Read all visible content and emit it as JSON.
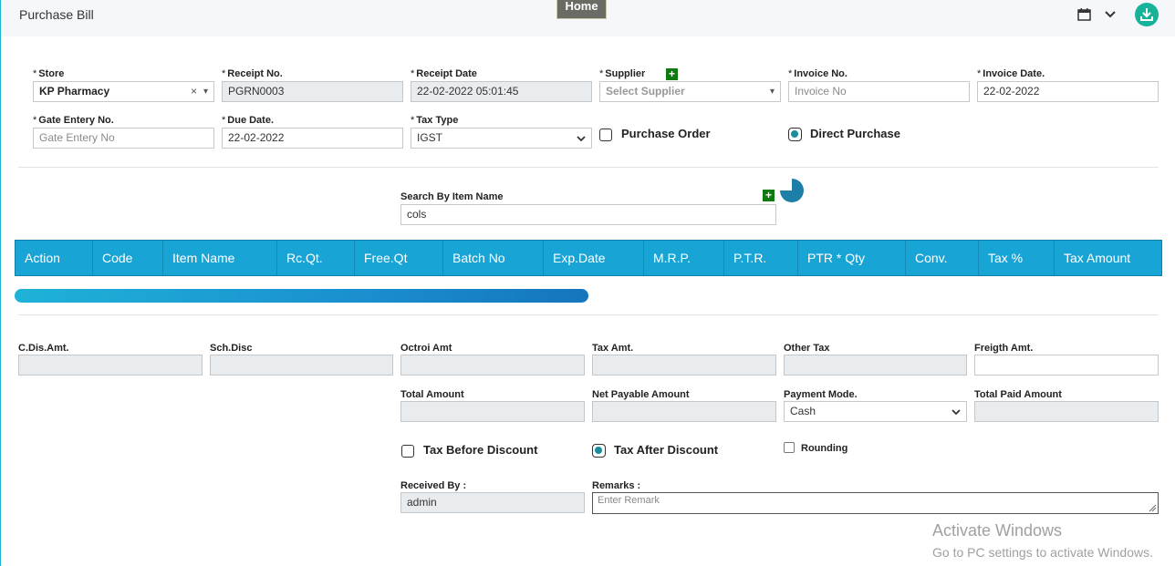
{
  "header": {
    "title": "Purchase Bill",
    "home_tab": "Home",
    "icons": [
      "calendar-icon",
      "chevron-down-icon",
      "download-icon"
    ]
  },
  "form": {
    "store": {
      "label": "Store",
      "value": "KP Pharmacy",
      "clear": "×"
    },
    "receipt_no": {
      "label": "Receipt No.",
      "value": "PGRN0003"
    },
    "receipt_date": {
      "label": "Receipt Date",
      "value": "22-02-2022 05:01:45"
    },
    "supplier": {
      "label": "Supplier",
      "placeholder": "Select Supplier"
    },
    "invoice_no": {
      "label": "Invoice No.",
      "placeholder": "Invoice No"
    },
    "invoice_date": {
      "label": "Invoice Date.",
      "value": "22-02-2022"
    },
    "gate_entry_no": {
      "label": "Gate Entery No.",
      "placeholder": "Gate Entery No"
    },
    "due_date": {
      "label": "Due Date.",
      "value": "22-02-2022"
    },
    "tax_type": {
      "label": "Tax Type",
      "value": "IGST"
    },
    "purchase_order": {
      "label": "Purchase Order",
      "checked": false
    },
    "direct_purchase": {
      "label": "Direct Purchase",
      "checked": true
    },
    "required_mark": "*"
  },
  "search": {
    "label": "Search By Item Name",
    "value": "cols"
  },
  "table": {
    "columns": [
      "Action",
      "Code",
      "Item Name",
      "Rc.Qt.",
      "Free.Qt",
      "Batch No",
      "Exp.Date",
      "M.R.P.",
      "P.T.R.",
      "PTR * Qty",
      "Conv.",
      "Tax %",
      "Tax Amount"
    ]
  },
  "totals": {
    "c_dis_amt": {
      "label": "C.Dis.Amt.",
      "value": ""
    },
    "sch_disc": {
      "label": "Sch.Disc",
      "value": ""
    },
    "octroi_amt": {
      "label": "Octroi Amt",
      "value": ""
    },
    "tax_amt": {
      "label": "Tax Amt.",
      "value": ""
    },
    "other_tax": {
      "label": "Other Tax",
      "value": ""
    },
    "freigth_amt": {
      "label": "Freigth Amt.",
      "value": ""
    },
    "total_amount": {
      "label": "Total Amount",
      "value": ""
    },
    "net_payable_amount": {
      "label": "Net Payable Amount",
      "value": ""
    },
    "payment_mode": {
      "label": "Payment Mode.",
      "value": "Cash"
    },
    "total_paid_amount": {
      "label": "Total Paid Amount",
      "value": ""
    },
    "tax_before_discount": {
      "label": "Tax Before Discount",
      "checked": false
    },
    "tax_after_discount": {
      "label": "Tax After Discount",
      "checked": true
    },
    "rounding": {
      "label": "Rounding",
      "checked": false
    },
    "received_by": {
      "label": "Received By :",
      "value": "admin"
    },
    "remarks": {
      "label": "Remarks :",
      "placeholder": "Enter Remark"
    }
  },
  "watermark": {
    "line1": "Activate Windows",
    "line2": "Go to PC settings to activate Windows."
  },
  "colors": {
    "table_header": "#19a4d6",
    "accent_teal": "#17b29a",
    "plus_green": "#0f7a0f"
  }
}
